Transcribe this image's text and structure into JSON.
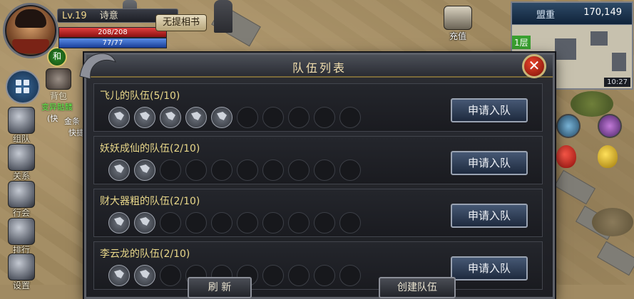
{
  "player": {
    "level": "Lv.19",
    "name": "诗意",
    "hp_text": "208/208",
    "hp_fraction": 1.0,
    "mp_text": "77/77",
    "mp_fraction": 1.0,
    "badge": "和",
    "scroll_label": "无提相书"
  },
  "sidebar": {
    "bag_label": "背包",
    "green_text": "变异骷髅",
    "items": [
      {
        "label": "组队",
        "icon": "team-icon"
      },
      {
        "label": "关系",
        "icon": "relation-icon"
      },
      {
        "label": "行会",
        "icon": "guild-icon"
      },
      {
        "label": "排行",
        "icon": "ranking-icon"
      },
      {
        "label": "设置",
        "icon": "settings-icon"
      }
    ]
  },
  "world_text": {
    "gold_partial": "金条",
    "paren_partial": "(快",
    "quick_partial": "快捷"
  },
  "topright": {
    "recharge_label": "充值",
    "server": "盟重",
    "coords": "170,149",
    "floor": "1层",
    "time": "10:27"
  },
  "dialog": {
    "title": "队伍列表",
    "close_glyph": "✕",
    "refresh_label": "刷 新",
    "create_label": "创建队伍",
    "teams": [
      {
        "name": "飞儿的队伍(5/10)",
        "members": 5,
        "capacity": 10,
        "button": "申请入队"
      },
      {
        "name": "妖妖成仙的队伍(2/10)",
        "members": 2,
        "capacity": 10,
        "button": "申请入队"
      },
      {
        "name": "财大器粗的队伍(2/10)",
        "members": 2,
        "capacity": 10,
        "button": "申请入队"
      },
      {
        "name": "李云龙的队伍(2/10)",
        "members": 2,
        "capacity": 10,
        "button": "申请入队"
      }
    ]
  },
  "colors": {
    "title_gold": "#f2dfae",
    "team_name": "#e9d88a",
    "hp_red": "#e04040",
    "mp_blue": "#5a8ee8",
    "close_red": "#e8442a"
  }
}
